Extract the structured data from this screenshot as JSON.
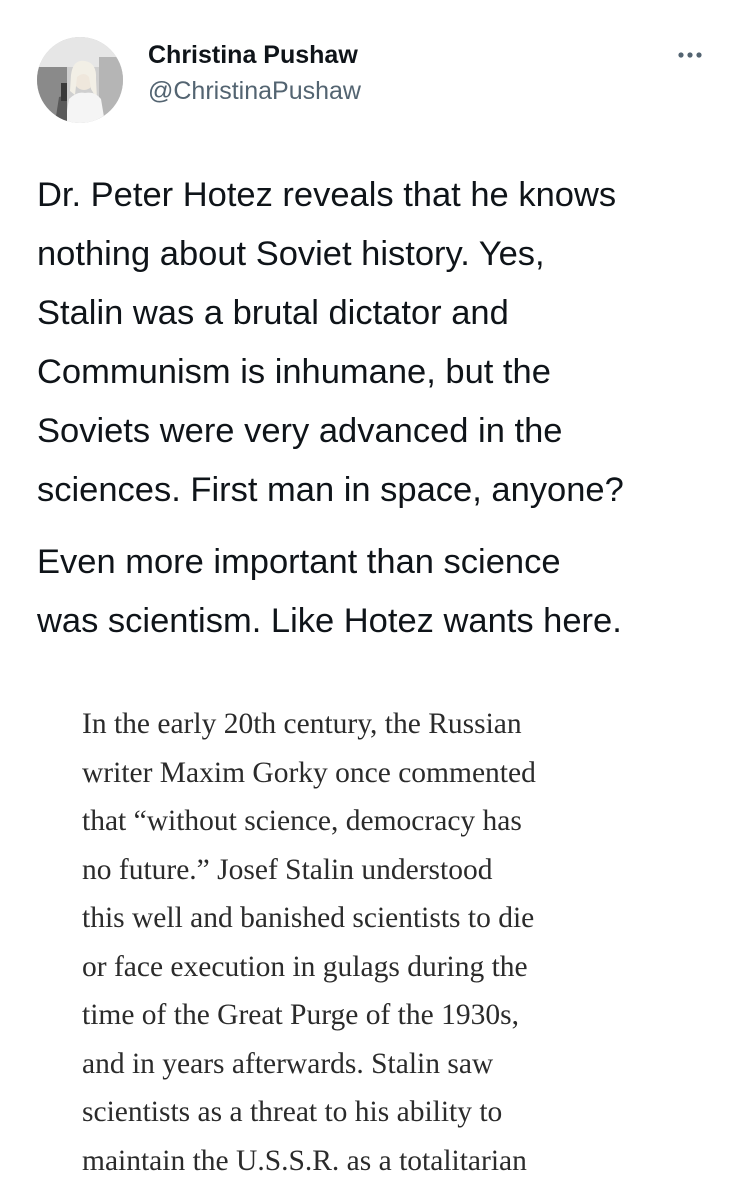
{
  "user": {
    "display_name": "Christina Pushaw",
    "handle": "@ChristinaPushaw",
    "more_icon": "more-horizontal-icon"
  },
  "tweet": {
    "paragraph_1_lines": [
      "Dr. Peter Hotez reveals that he knows",
      "nothing about Soviet history. Yes,",
      "Stalin was a brutal dictator and",
      "Communism is inhumane, but the",
      "Soviets were very advanced in the",
      "sciences. First man in space, anyone?"
    ],
    "paragraph_2_lines": [
      "Even more important than science",
      "was scientism. Like Hotez wants here."
    ]
  },
  "quote": {
    "lines": [
      "In the early 20th century, the Russian",
      "writer Maxim Gorky once commented",
      "that “without science, democracy has",
      "no future.” Josef Stalin understood",
      "this well and banished scientists to die",
      "or face execution in gulags during the",
      "time of the Great Purge of the 1930s,",
      "and in years afterwards. Stalin saw",
      "scientists as a threat to his ability to",
      "maintain the U.S.S.R. as a totalitarian"
    ]
  },
  "colors": {
    "text_primary": "#0f1419",
    "text_secondary": "#536471",
    "quote_text": "#2b2b2b",
    "background": "#ffffff"
  }
}
